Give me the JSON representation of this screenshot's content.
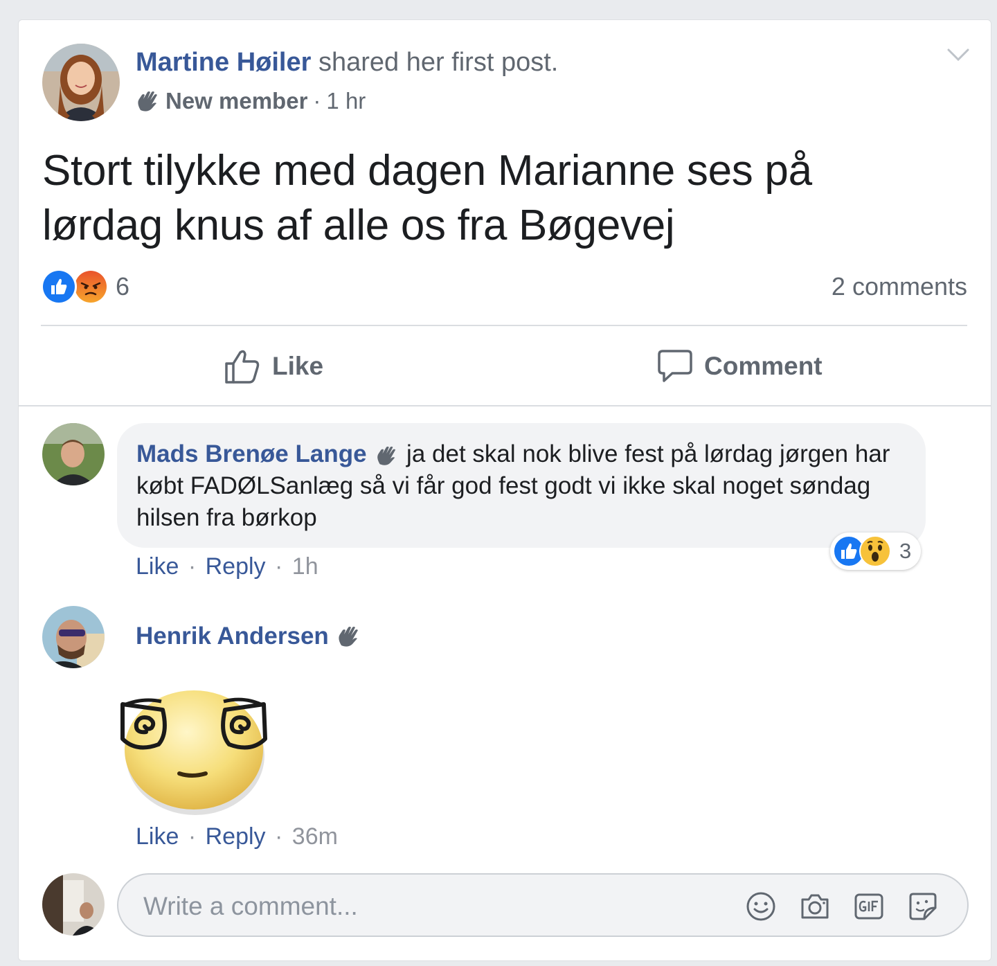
{
  "post": {
    "author": "Martine Høiler",
    "action_text": "shared her first post.",
    "badge": "New member",
    "separator": "·",
    "time": "1 hr",
    "text": "Stort tilykke med dagen Marianne ses på lørdag knus af alle os fra Bøgevej",
    "reaction_count": "6",
    "comments_count": "2 comments"
  },
  "actions": {
    "like_label": "Like",
    "comment_label": "Comment"
  },
  "comments": [
    {
      "author": "Mads Brenøe Lange",
      "text": "ja det skal nok blive fest på lørdag jørgen har købt FADØLSanlæg så vi får god fest godt vi ikke skal noget søndag hilsen fra børkop",
      "reaction_count": "3",
      "like_label": "Like",
      "reply_label": "Reply",
      "separator": "·",
      "time": "1h"
    },
    {
      "author": "Henrik Andersen",
      "like_label": "Like",
      "reply_label": "Reply",
      "separator": "·",
      "time": "36m"
    }
  ],
  "composer": {
    "placeholder": "Write a comment..."
  },
  "colors": {
    "link": "#385898",
    "secondary_text": "#606770",
    "like_blue": "#1877f2",
    "angry_orange": "#f0642a"
  },
  "icons": [
    "chevron-down-icon",
    "wave-icon",
    "like-reaction-icon",
    "angry-reaction-icon",
    "wow-reaction-icon",
    "thumbs-up-icon",
    "speech-bubble-icon",
    "emoji-icon",
    "camera-icon",
    "gif-icon",
    "sticker-icon"
  ]
}
